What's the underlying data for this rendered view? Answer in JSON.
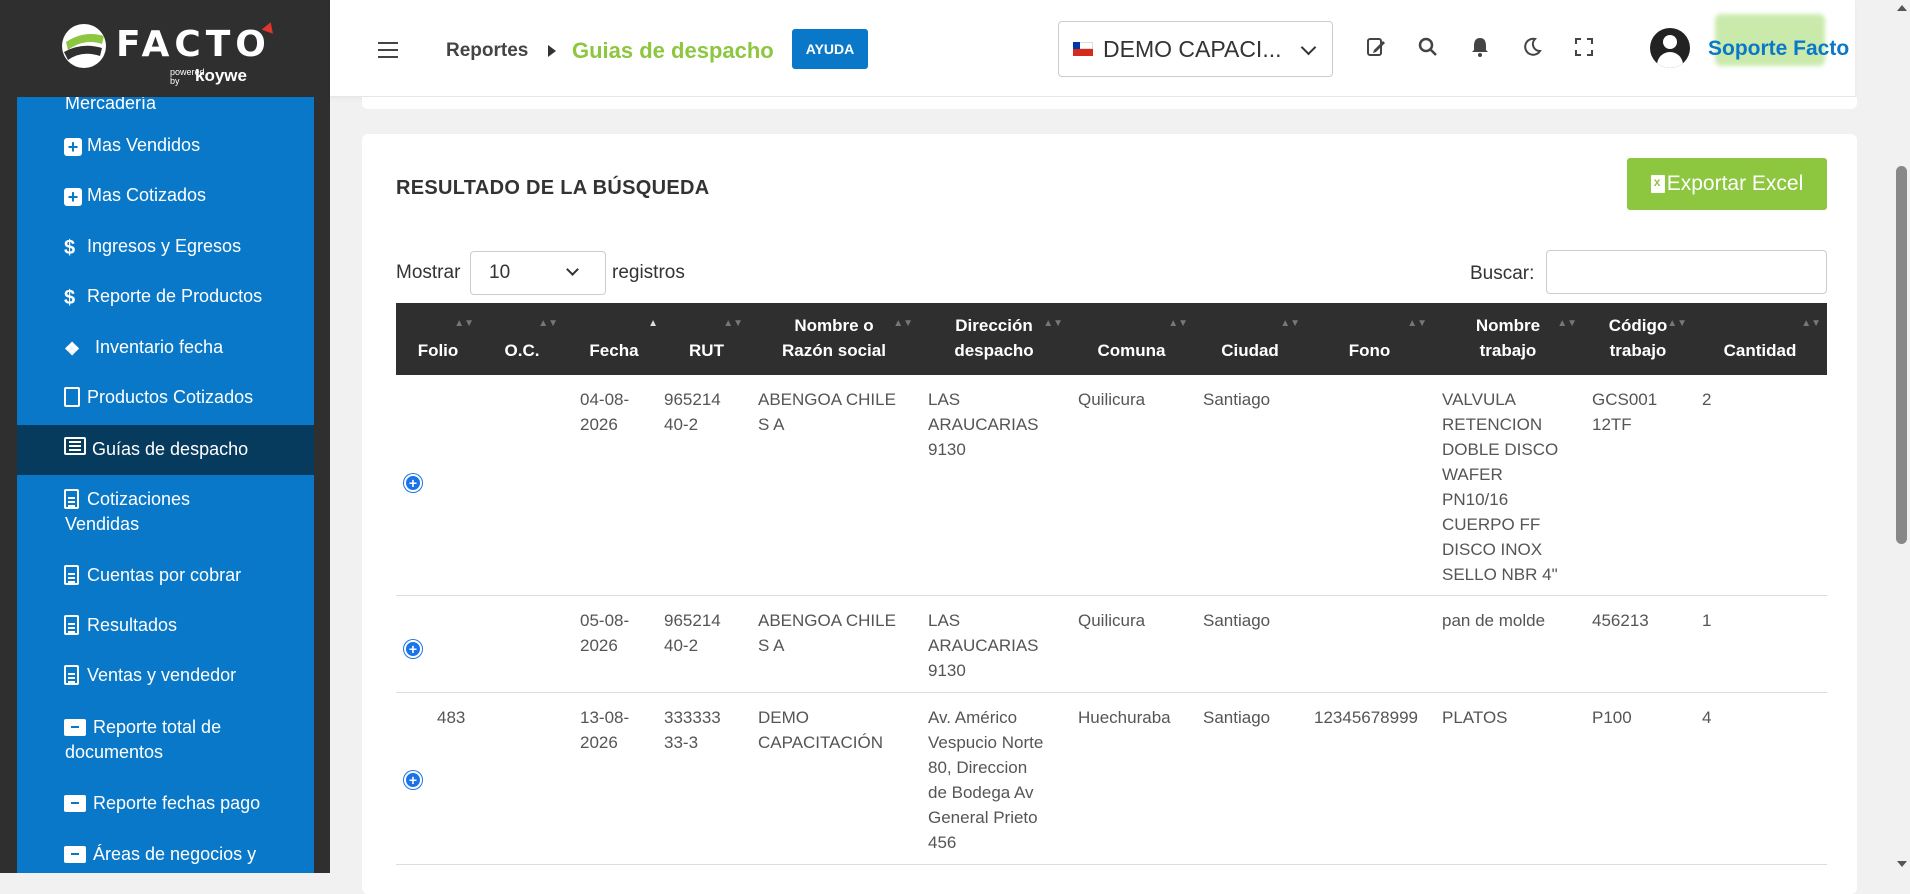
{
  "brand": {
    "name": "FACTO",
    "powered": "powered by",
    "partner": "koywe"
  },
  "sidebar": {
    "items": [
      {
        "label": "Mercadería",
        "icon": "none",
        "active": false
      },
      {
        "label": "Mas Vendidos",
        "icon": "plus-square-icon",
        "active": false
      },
      {
        "label": "Mas Cotizados",
        "icon": "plus-square-icon",
        "active": false
      },
      {
        "label": "Ingresos y Egresos",
        "icon": "dollar-icon",
        "active": false
      },
      {
        "label": "Reporte de Productos",
        "icon": "dollar-icon",
        "active": false
      },
      {
        "label": "Inventario fecha",
        "icon": "cubes-icon",
        "active": false
      },
      {
        "label": "Productos Cotizados",
        "icon": "calculator-icon",
        "active": false
      },
      {
        "label": "Guías de despacho",
        "icon": "list-icon",
        "active": true
      },
      {
        "label_line1": "Cotizaciones",
        "label_line2": "Vendidas",
        "icon": "document-icon",
        "active": false
      },
      {
        "label": "Cuentas por cobrar",
        "icon": "document-icon",
        "active": false
      },
      {
        "label": "Resultados",
        "icon": "document-icon",
        "active": false
      },
      {
        "label": "Ventas y vendedor",
        "icon": "document-icon",
        "active": false
      },
      {
        "label_line1": "Reporte total de",
        "label_line2": "documentos",
        "icon": "archive-icon",
        "active": false
      },
      {
        "label": "Reporte fechas pago",
        "icon": "archive-icon",
        "active": false
      },
      {
        "label": "Áreas de negocios y",
        "icon": "archive-icon",
        "active": false
      }
    ]
  },
  "header": {
    "breadcrumb_root": "Reportes",
    "breadcrumb_current": "Guias de despacho",
    "help_label": "AYUDA",
    "company": "DEMO CAPACI...",
    "user": "Soporte Facto"
  },
  "main": {
    "title": "RESULTADO DE LA BÚSQUEDA",
    "export_label": "Exportar Excel",
    "show_label": "Mostrar",
    "page_size": "10",
    "records_label": "registros",
    "search_label": "Buscar:",
    "search_value": ""
  },
  "table": {
    "headers": [
      {
        "l1": "",
        "l2": "Folio"
      },
      {
        "l1": "",
        "l2": "O.C."
      },
      {
        "l1": "",
        "l2": "Fecha"
      },
      {
        "l1": "",
        "l2": "RUT"
      },
      {
        "l1": "Nombre o",
        "l2": "Razón social"
      },
      {
        "l1": "Dirección",
        "l2": "despacho"
      },
      {
        "l1": "",
        "l2": "Comuna"
      },
      {
        "l1": "",
        "l2": "Ciudad"
      },
      {
        "l1": "",
        "l2": "Fono"
      },
      {
        "l1": "Nombre",
        "l2": "trabajo"
      },
      {
        "l1": "Código",
        "l2": "trabajo"
      },
      {
        "l1": "",
        "l2": "Cantidad"
      }
    ],
    "rows": [
      {
        "folio": "",
        "oc": "",
        "fecha": [
          "04-08-",
          "2026"
        ],
        "rut": [
          "965214",
          "40-2"
        ],
        "nombre": [
          "ABENGOA CHILE",
          "S A"
        ],
        "direccion": [
          "LAS",
          "ARAUCARIAS",
          "9130"
        ],
        "comuna": "Quilicura",
        "ciudad": "Santiago",
        "fono": "",
        "trabajo": [
          "VALVULA",
          "RETENCION",
          "DOBLE DISCO",
          "WAFER",
          "PN10/16",
          "CUERPO FF",
          "DISCO INOX",
          "SELLO NBR 4\""
        ],
        "codigo": [
          "GCS001",
          "12TF"
        ],
        "cantidad": "2"
      },
      {
        "folio": "",
        "oc": "",
        "fecha": [
          "05-08-",
          "2026"
        ],
        "rut": [
          "965214",
          "40-2"
        ],
        "nombre": [
          "ABENGOA CHILE",
          "S A"
        ],
        "direccion": [
          "LAS",
          "ARAUCARIAS",
          "9130"
        ],
        "comuna": "Quilicura",
        "ciudad": "Santiago",
        "fono": "",
        "trabajo": [
          "pan de molde"
        ],
        "codigo": [
          "456213"
        ],
        "cantidad": "1"
      },
      {
        "folio": "483",
        "oc": "",
        "fecha": [
          "13-08-",
          "2026"
        ],
        "rut": [
          "333333",
          "33-3"
        ],
        "nombre": [
          "DEMO",
          "CAPACITACIÓN"
        ],
        "direccion": [
          "Av. Américo",
          "Vespucio Norte",
          "80, Direccion",
          "de Bodega Av",
          "General Prieto",
          "456"
        ],
        "comuna": "Huechuraba",
        "ciudad": "Santiago",
        "fono": "12345678999",
        "trabajo": [
          "PLATOS"
        ],
        "codigo": [
          "P100"
        ],
        "cantidad": "4"
      }
    ]
  },
  "colors": {
    "accent": "#0a78c8",
    "brand_green": "#8dc63f",
    "sidebar_dark": "#2f2f2f",
    "active_item": "#063b5e"
  }
}
